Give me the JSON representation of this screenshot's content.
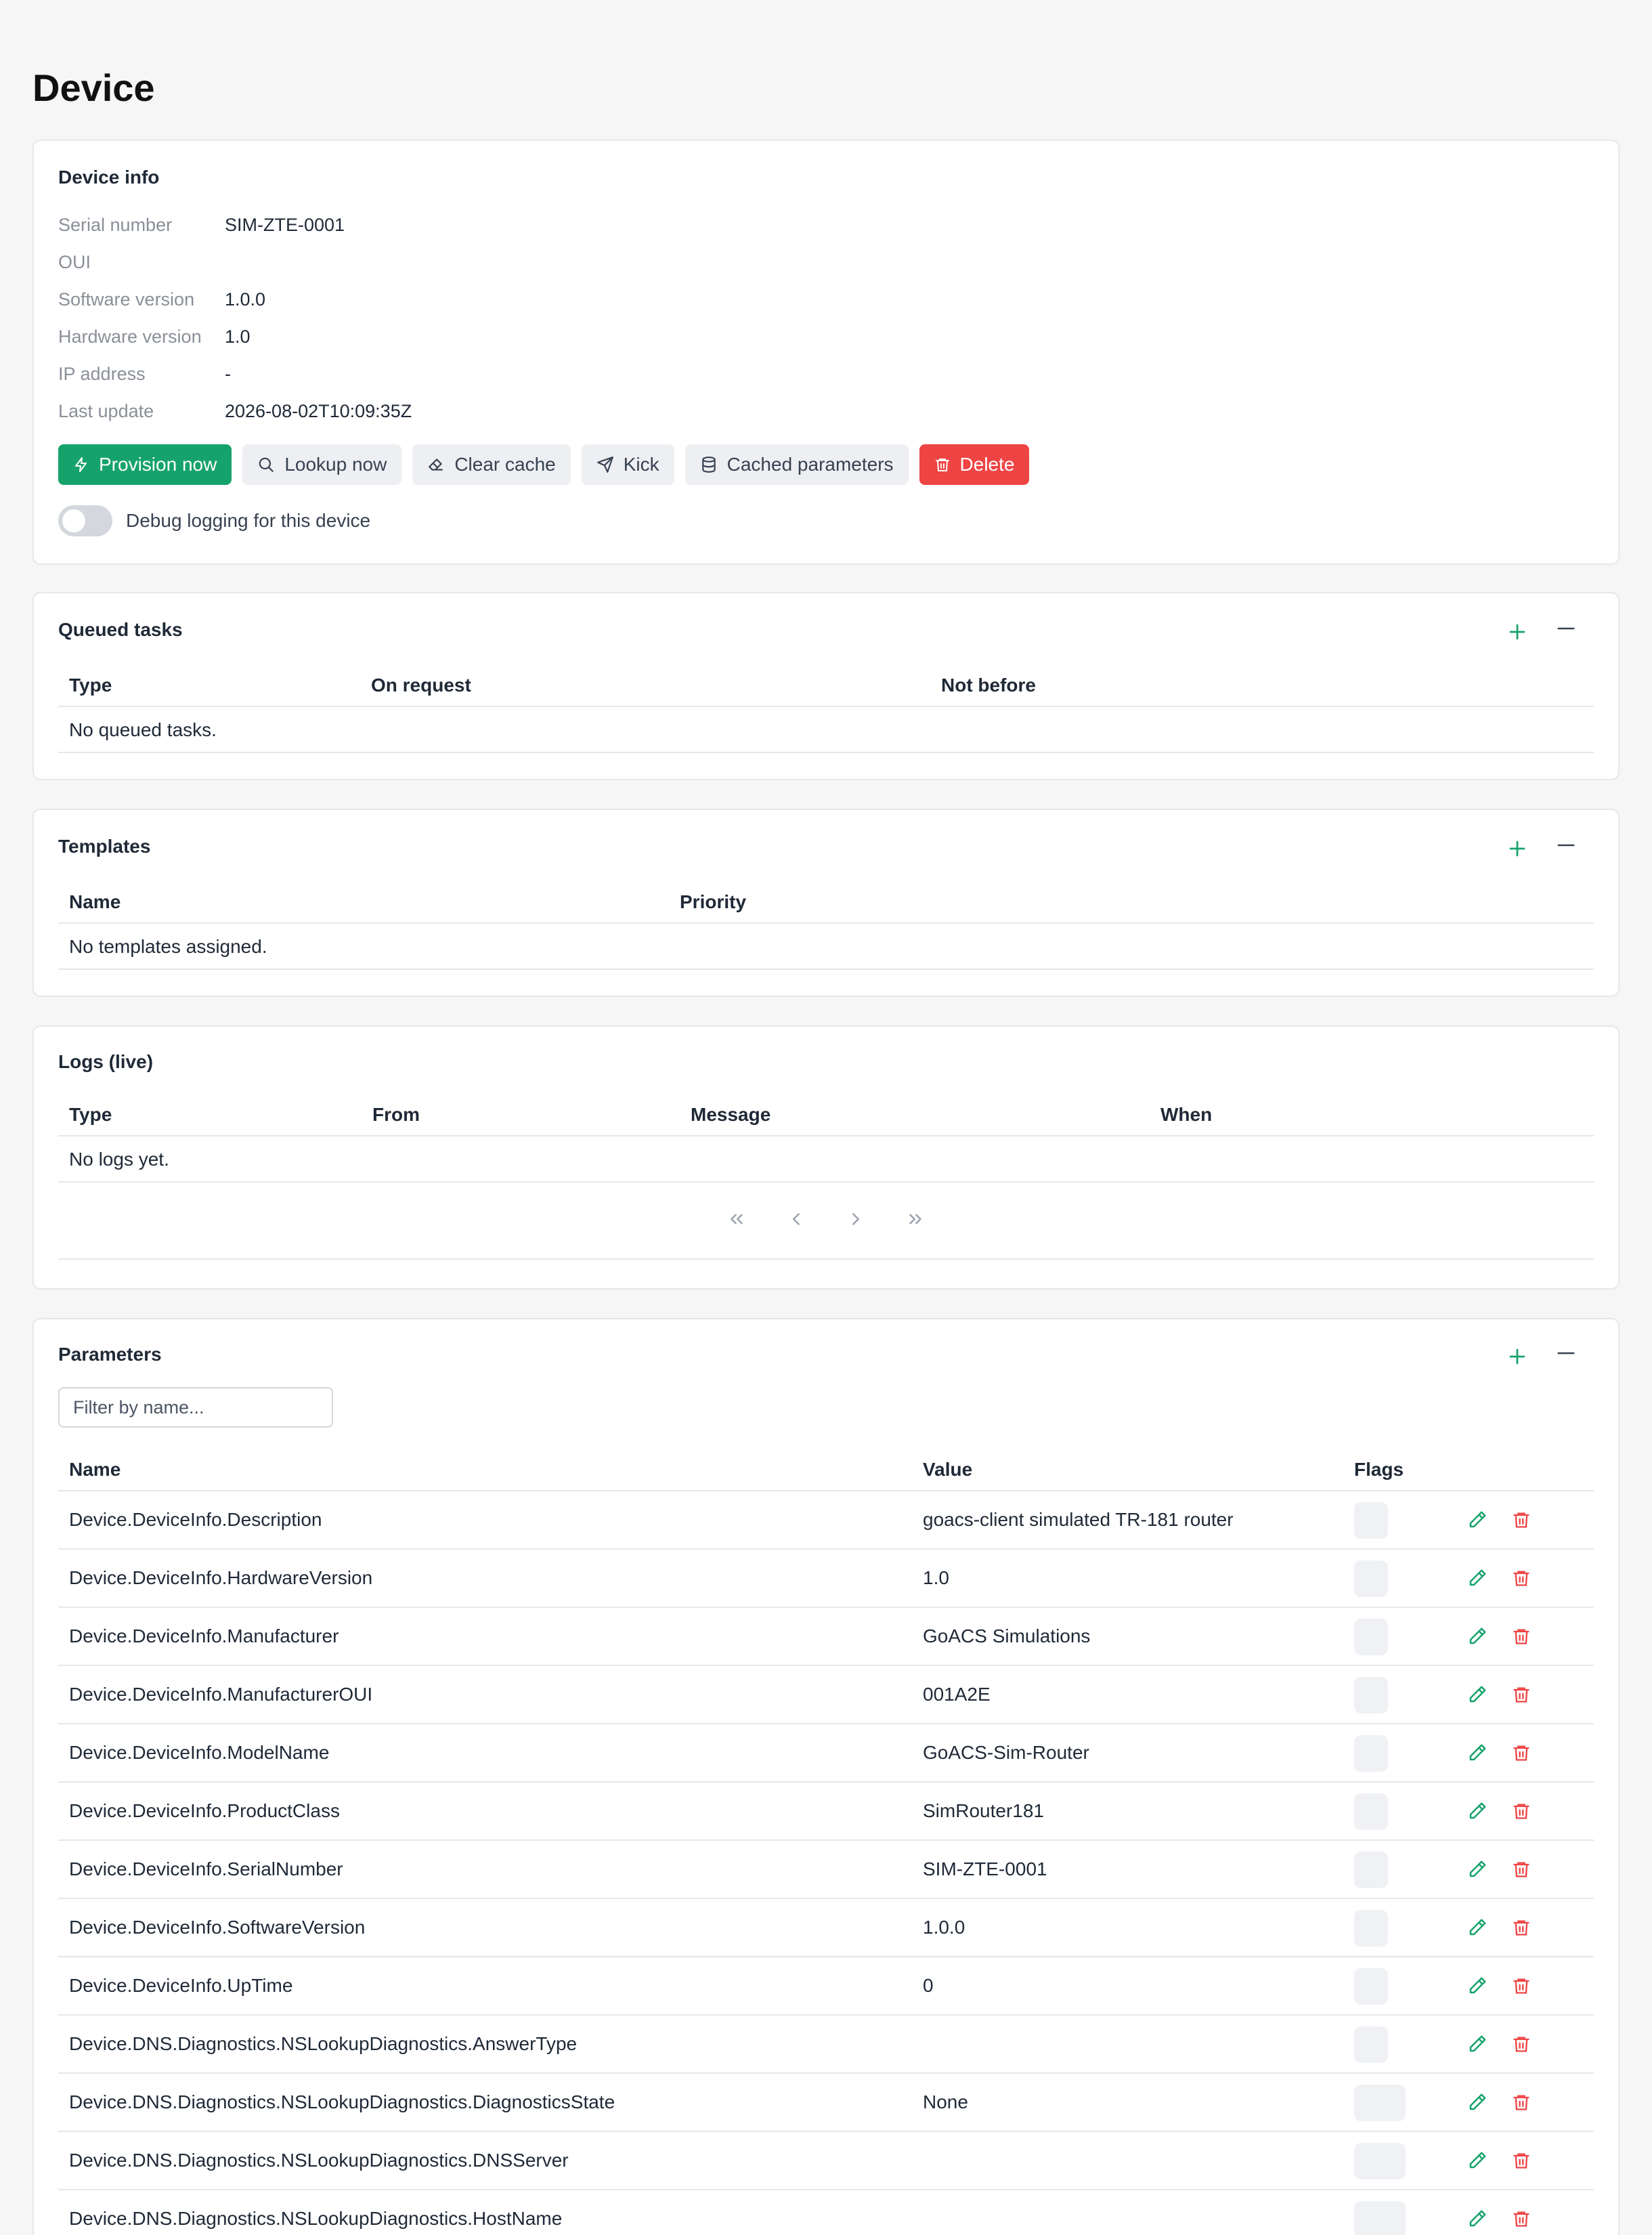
{
  "page": {
    "title": "Device"
  },
  "device_info": {
    "title": "Device info",
    "fields": [
      {
        "label": "Serial number",
        "value": "SIM-ZTE-0001"
      },
      {
        "label": "OUI",
        "value": ""
      },
      {
        "label": "Software version",
        "value": "1.0.0"
      },
      {
        "label": "Hardware version",
        "value": "1.0"
      },
      {
        "label": "IP address",
        "value": "-"
      },
      {
        "label": "Last update",
        "value": "2026-08-02T10:09:35Z"
      }
    ],
    "actions": {
      "provision": "Provision now",
      "lookup": "Lookup now",
      "clear_cache": "Clear cache",
      "kick": "Kick",
      "cached": "Cached parameters",
      "delete": "Delete"
    },
    "debug_label": "Debug logging for this device",
    "debug_enabled": false
  },
  "queued_tasks": {
    "title": "Queued tasks",
    "columns": [
      "Type",
      "On request",
      "Not before"
    ],
    "empty": "No queued tasks."
  },
  "templates": {
    "title": "Templates",
    "columns": [
      "Name",
      "Priority"
    ],
    "empty": "No templates assigned."
  },
  "logs": {
    "title": "Logs (live)",
    "columns": [
      "Type",
      "From",
      "Message",
      "When"
    ],
    "empty": "No logs yet."
  },
  "parameters": {
    "title": "Parameters",
    "filter_placeholder": "Filter by name...",
    "columns": [
      "Name",
      "Value",
      "Flags"
    ],
    "rows": [
      {
        "name": "Device.DeviceInfo.Description",
        "value": "goacs-client simulated TR-181 router"
      },
      {
        "name": "Device.DeviceInfo.HardwareVersion",
        "value": "1.0"
      },
      {
        "name": "Device.DeviceInfo.Manufacturer",
        "value": "GoACS Simulations"
      },
      {
        "name": "Device.DeviceInfo.ManufacturerOUI",
        "value": "001A2E"
      },
      {
        "name": "Device.DeviceInfo.ModelName",
        "value": "GoACS-Sim-Router"
      },
      {
        "name": "Device.DeviceInfo.ProductClass",
        "value": "SimRouter181"
      },
      {
        "name": "Device.DeviceInfo.SerialNumber",
        "value": "SIM-ZTE-0001"
      },
      {
        "name": "Device.DeviceInfo.SoftwareVersion",
        "value": "1.0.0"
      },
      {
        "name": "Device.DeviceInfo.UpTime",
        "value": "0"
      },
      {
        "name": "Device.DNS.Diagnostics.NSLookupDiagnostics.AnswerType",
        "value": ""
      },
      {
        "name": "Device.DNS.Diagnostics.NSLookupDiagnostics.DiagnosticsState",
        "value": "None"
      },
      {
        "name": "Device.DNS.Diagnostics.NSLookupDiagnostics.DNSServer",
        "value": ""
      },
      {
        "name": "Device.DNS.Diagnostics.NSLookupDiagnostics.HostName",
        "value": ""
      }
    ]
  },
  "colors": {
    "accent": "#16a36b",
    "danger": "#ef4444",
    "muted": "#8a8f98"
  }
}
